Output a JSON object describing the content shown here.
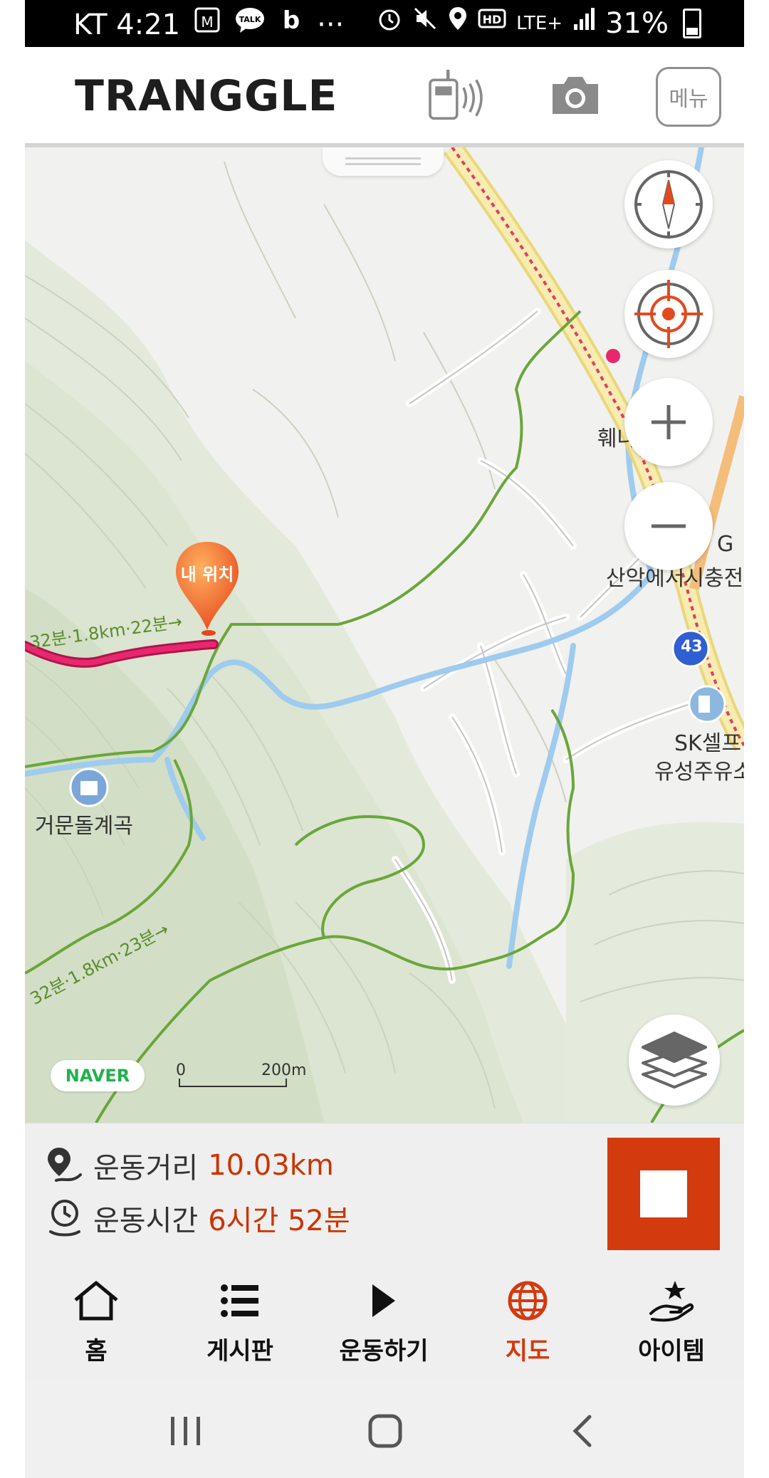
{
  "status_bar": {
    "carrier_time": "KT 4:21",
    "overflow": "···",
    "network": "LTE+",
    "battery": "31%"
  },
  "header": {
    "logo": "TRANGGLE",
    "menu_label": "메뉴"
  },
  "map": {
    "labels": {
      "geomundol": "거문돌계곡",
      "sk_line1": "SK셀프",
      "sk_line2": "유성주유소",
      "road_number": "43",
      "upper_right_1": "훼나",
      "upper_right_2": "G",
      "upper_right_3": "산악에서시충전"
    },
    "route_notes": {
      "top": "32분·1.8km·22분→",
      "bottom": "32분·1.8km·23분→"
    },
    "marker_label": "내 위치",
    "naver_logo": "NAVER",
    "scale": {
      "start": "0",
      "end": "200m"
    }
  },
  "info": {
    "distance_label": "운동거리",
    "distance_value": "10.03km",
    "time_label": "운동시간",
    "time_value": "6시간 52분"
  },
  "nav": {
    "home": "홈",
    "board": "게시판",
    "exercise": "운동하기",
    "map": "지도",
    "items": "아이템"
  },
  "colors": {
    "accent": "#d33a0e",
    "route": "#e8286e",
    "trail": "#6aa63a",
    "stream": "#8fc3e8"
  }
}
